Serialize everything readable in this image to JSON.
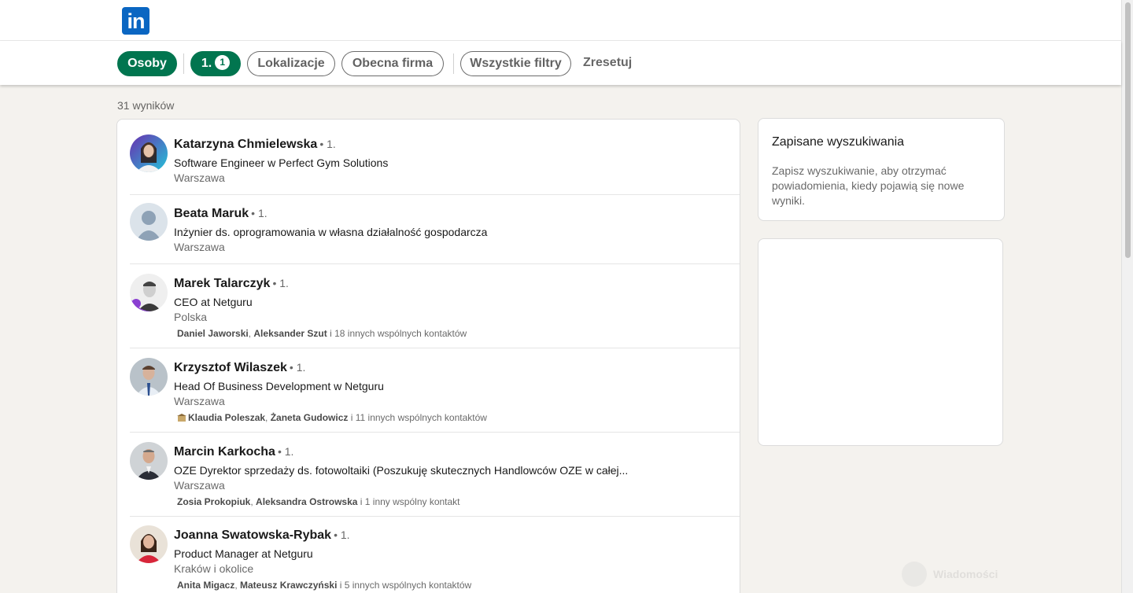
{
  "header": {
    "logo_text": "in"
  },
  "filters": {
    "people": "Osoby",
    "connections": "1.",
    "connections_count": "1",
    "locations": "Lokalizacje",
    "current_company": "Obecna firma",
    "all_filters": "Wszystkie filtry",
    "reset": "Zresetuj"
  },
  "results_count": "31 wyników",
  "results": [
    {
      "name": "Katarzyna Chmielewska",
      "degree": "• 1.",
      "headline": "Software Engineer w Perfect Gym Solutions",
      "location": "Warszawa"
    },
    {
      "name": "Beata Maruk",
      "degree": "• 1.",
      "headline": "Inżynier ds. oprogramowania w własna działalność gospodarcza",
      "location": "Warszawa"
    },
    {
      "name": "Marek Talarczyk",
      "degree": "• 1.",
      "headline": "CEO at Netguru",
      "location": "Polska",
      "mutual_a": "Daniel Jaworski",
      "mutual_b": "Aleksander Szut",
      "mutual_rest": "i 18 innych wspólnych kontaktów"
    },
    {
      "name": "Krzysztof Wilaszek",
      "degree": "• 1.",
      "headline": "Head Of Business Development w Netguru",
      "location": "Warszawa",
      "mutual_a": "Klaudia Poleszak",
      "mutual_b": "Żaneta Gudowicz",
      "mutual_rest": "i 11 innych wspólnych kontaktów"
    },
    {
      "name": "Marcin Karkocha",
      "degree": "• 1.",
      "headline": "OZE Dyrektor sprzedaży ds. fotowoltaiki (Poszukuję skutecznych Handlowców OZE w całej...",
      "location": "Warszawa",
      "mutual_a": "Zosia Prokopiuk",
      "mutual_b": "Aleksandra Ostrowska",
      "mutual_rest": "i 1 inny wspólny kontakt"
    },
    {
      "name": "Joanna Swatowska-Rybak",
      "degree": "• 1.",
      "headline": "Product Manager at Netguru",
      "location": "Kraków i okolice",
      "mutual_a": "Anita Migacz",
      "mutual_b": "Mateusz Krawczyński",
      "mutual_rest": "i 5 innych wspólnych kontaktów"
    }
  ],
  "sidebar": {
    "saved_title": "Zapisane wyszukiwania",
    "saved_desc": "Zapisz wyszukiwanie, aby otrzymać powiadomienia, kiedy pojawią się nowe wyniki."
  },
  "messaging": {
    "label": "Wiadomości"
  },
  "colors": {
    "brand": "#0a66c2",
    "active_filter": "#01754f",
    "background": "#f4f2ee"
  }
}
